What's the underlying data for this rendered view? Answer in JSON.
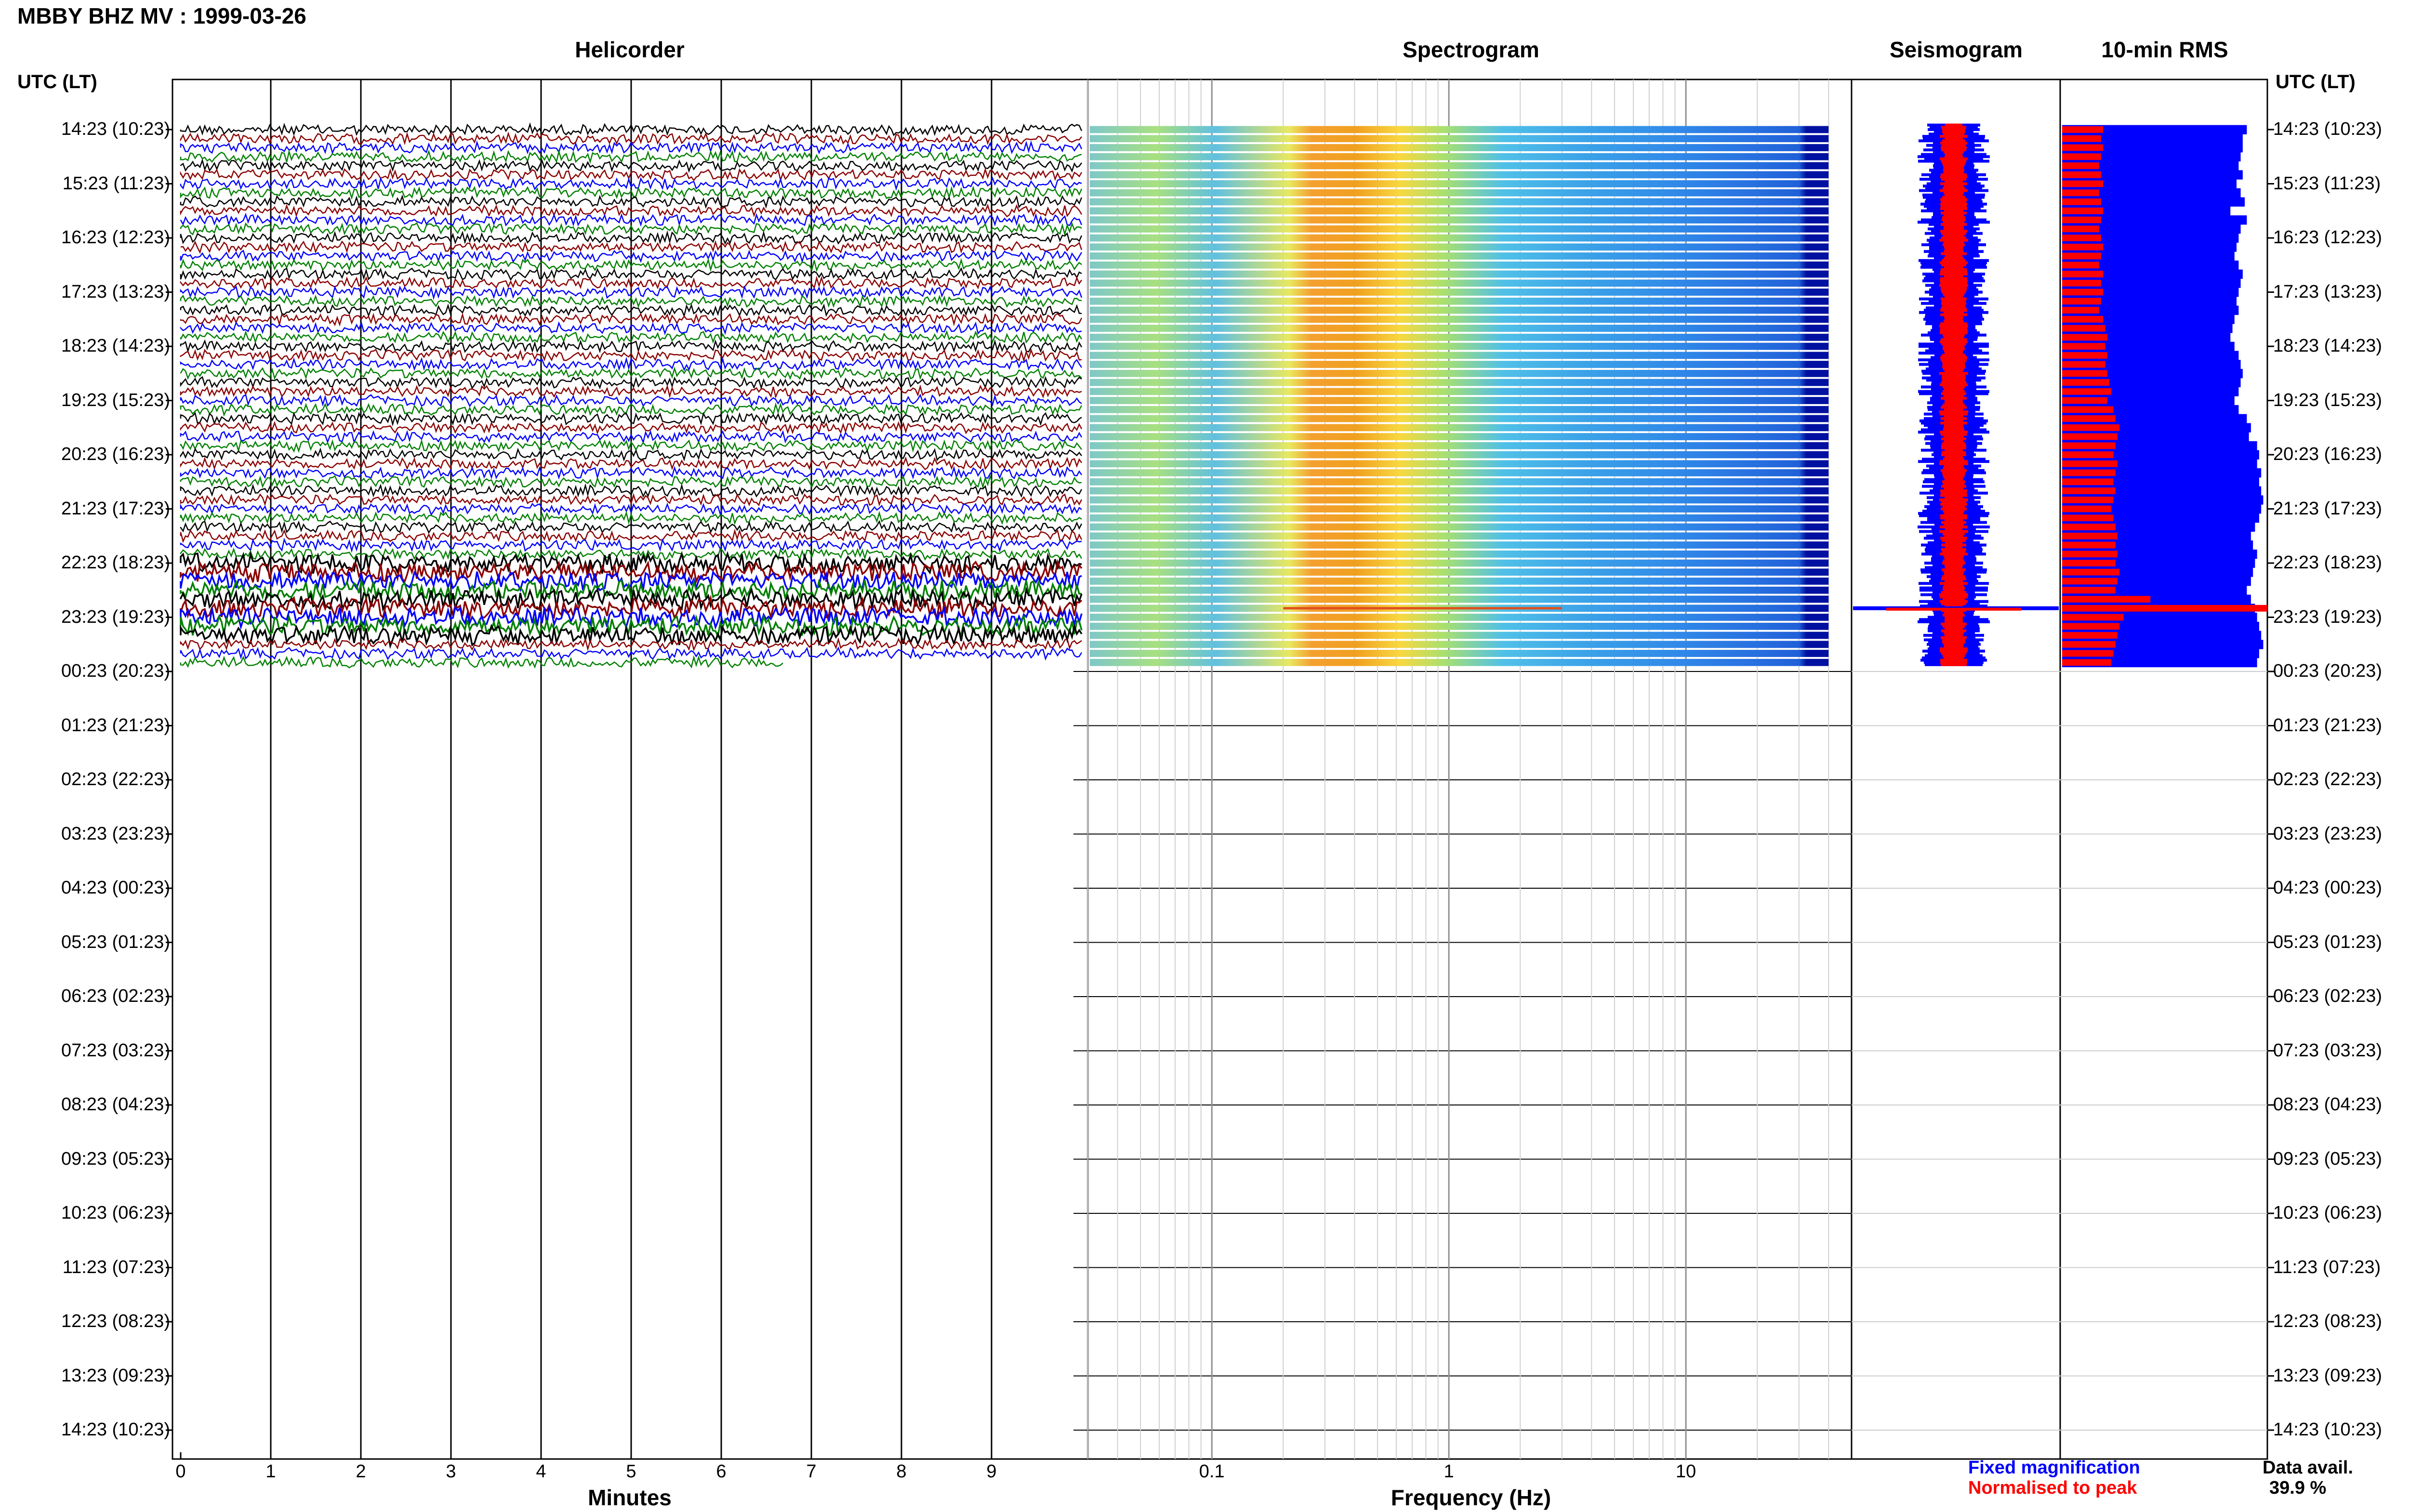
{
  "header": {
    "title": "MBBY BHZ MV : 1999-03-26",
    "panels": [
      "Helicorder",
      "Spectrogram",
      "Seismogram",
      "10-min RMS"
    ],
    "y_axis_label": "UTC (LT)"
  },
  "colors": {
    "trace_cycle": [
      "#000000",
      "#8b0000",
      "#0000ff",
      "#008000"
    ],
    "fixed": "#0000ff",
    "normalised": "#ff0000"
  },
  "chart_data": {
    "type": "line",
    "y_ticks": [
      "14:23 (10:23)",
      "15:23 (11:23)",
      "16:23 (12:23)",
      "17:23 (13:23)",
      "18:23 (14:23)",
      "19:23 (15:23)",
      "20:23 (16:23)",
      "21:23 (17:23)",
      "22:23 (18:23)",
      "23:23 (19:23)",
      "00:23 (20:23)",
      "01:23 (21:23)",
      "02:23 (22:23)",
      "03:23 (23:23)",
      "04:23 (00:23)",
      "05:23 (01:23)",
      "06:23 (02:23)",
      "07:23 (03:23)",
      "08:23 (04:23)",
      "09:23 (05:23)",
      "10:23 (06:23)",
      "11:23 (07:23)",
      "12:23 (08:23)",
      "13:23 (09:23)",
      "14:23 (10:23)"
    ],
    "helicorder": {
      "xlabel": "Minutes",
      "x_ticks": [
        "0",
        "1",
        "2",
        "3",
        "4",
        "5",
        "6",
        "7",
        "8",
        "9"
      ],
      "xlim": [
        0,
        10
      ],
      "data_end_minute": 6.7
    },
    "spectrogram": {
      "xlabel": "Frequency (Hz)",
      "x_ticks": [
        "0.1",
        "1",
        "10"
      ],
      "xlim": [
        0.03,
        50
      ],
      "x_scale": "log",
      "data_max_hz": 40,
      "peak_band_hz": [
        0.2,
        0.5
      ]
    },
    "rms": {
      "blue": [
        0.9,
        0.88,
        0.88,
        0.87,
        0.86,
        0.88,
        0.85,
        0.87,
        0.89,
        0.82,
        0.9,
        0.87,
        0.86,
        0.85,
        0.84,
        0.86,
        0.88,
        0.87,
        0.86,
        0.85,
        0.86,
        0.84,
        0.83,
        0.82,
        0.84,
        0.86,
        0.87,
        0.88,
        0.87,
        0.86,
        0.84,
        0.86,
        0.9,
        0.92,
        0.91,
        0.95,
        0.96,
        0.95,
        0.97,
        0.96,
        0.97,
        0.98,
        0.97,
        0.96,
        0.94,
        0.92,
        0.93,
        0.95,
        0.94,
        0.93,
        0.92,
        0.9,
        0.92,
        0.94,
        0.95,
        0.96,
        0.97,
        0.98,
        0.96,
        0.95
      ],
      "red": [
        0.2,
        0.19,
        0.2,
        0.19,
        0.18,
        0.19,
        0.2,
        0.18,
        0.19,
        0.2,
        0.19,
        0.18,
        0.19,
        0.2,
        0.19,
        0.18,
        0.2,
        0.19,
        0.2,
        0.19,
        0.18,
        0.2,
        0.21,
        0.22,
        0.21,
        0.22,
        0.21,
        0.22,
        0.23,
        0.24,
        0.22,
        0.25,
        0.26,
        0.28,
        0.27,
        0.26,
        0.25,
        0.27,
        0.26,
        0.25,
        0.26,
        0.25,
        0.24,
        0.25,
        0.26,
        0.27,
        0.26,
        0.27,
        0.26,
        0.28,
        0.27,
        0.26,
        0.43,
        1.0,
        0.3,
        0.28,
        0.27,
        0.26,
        0.25,
        0.24
      ]
    }
  },
  "legend": {
    "fixed": "Fixed magnification",
    "normalised": "Normalised to peak",
    "data_avail_label": "Data avail.",
    "data_avail_value": "39.9 %"
  }
}
